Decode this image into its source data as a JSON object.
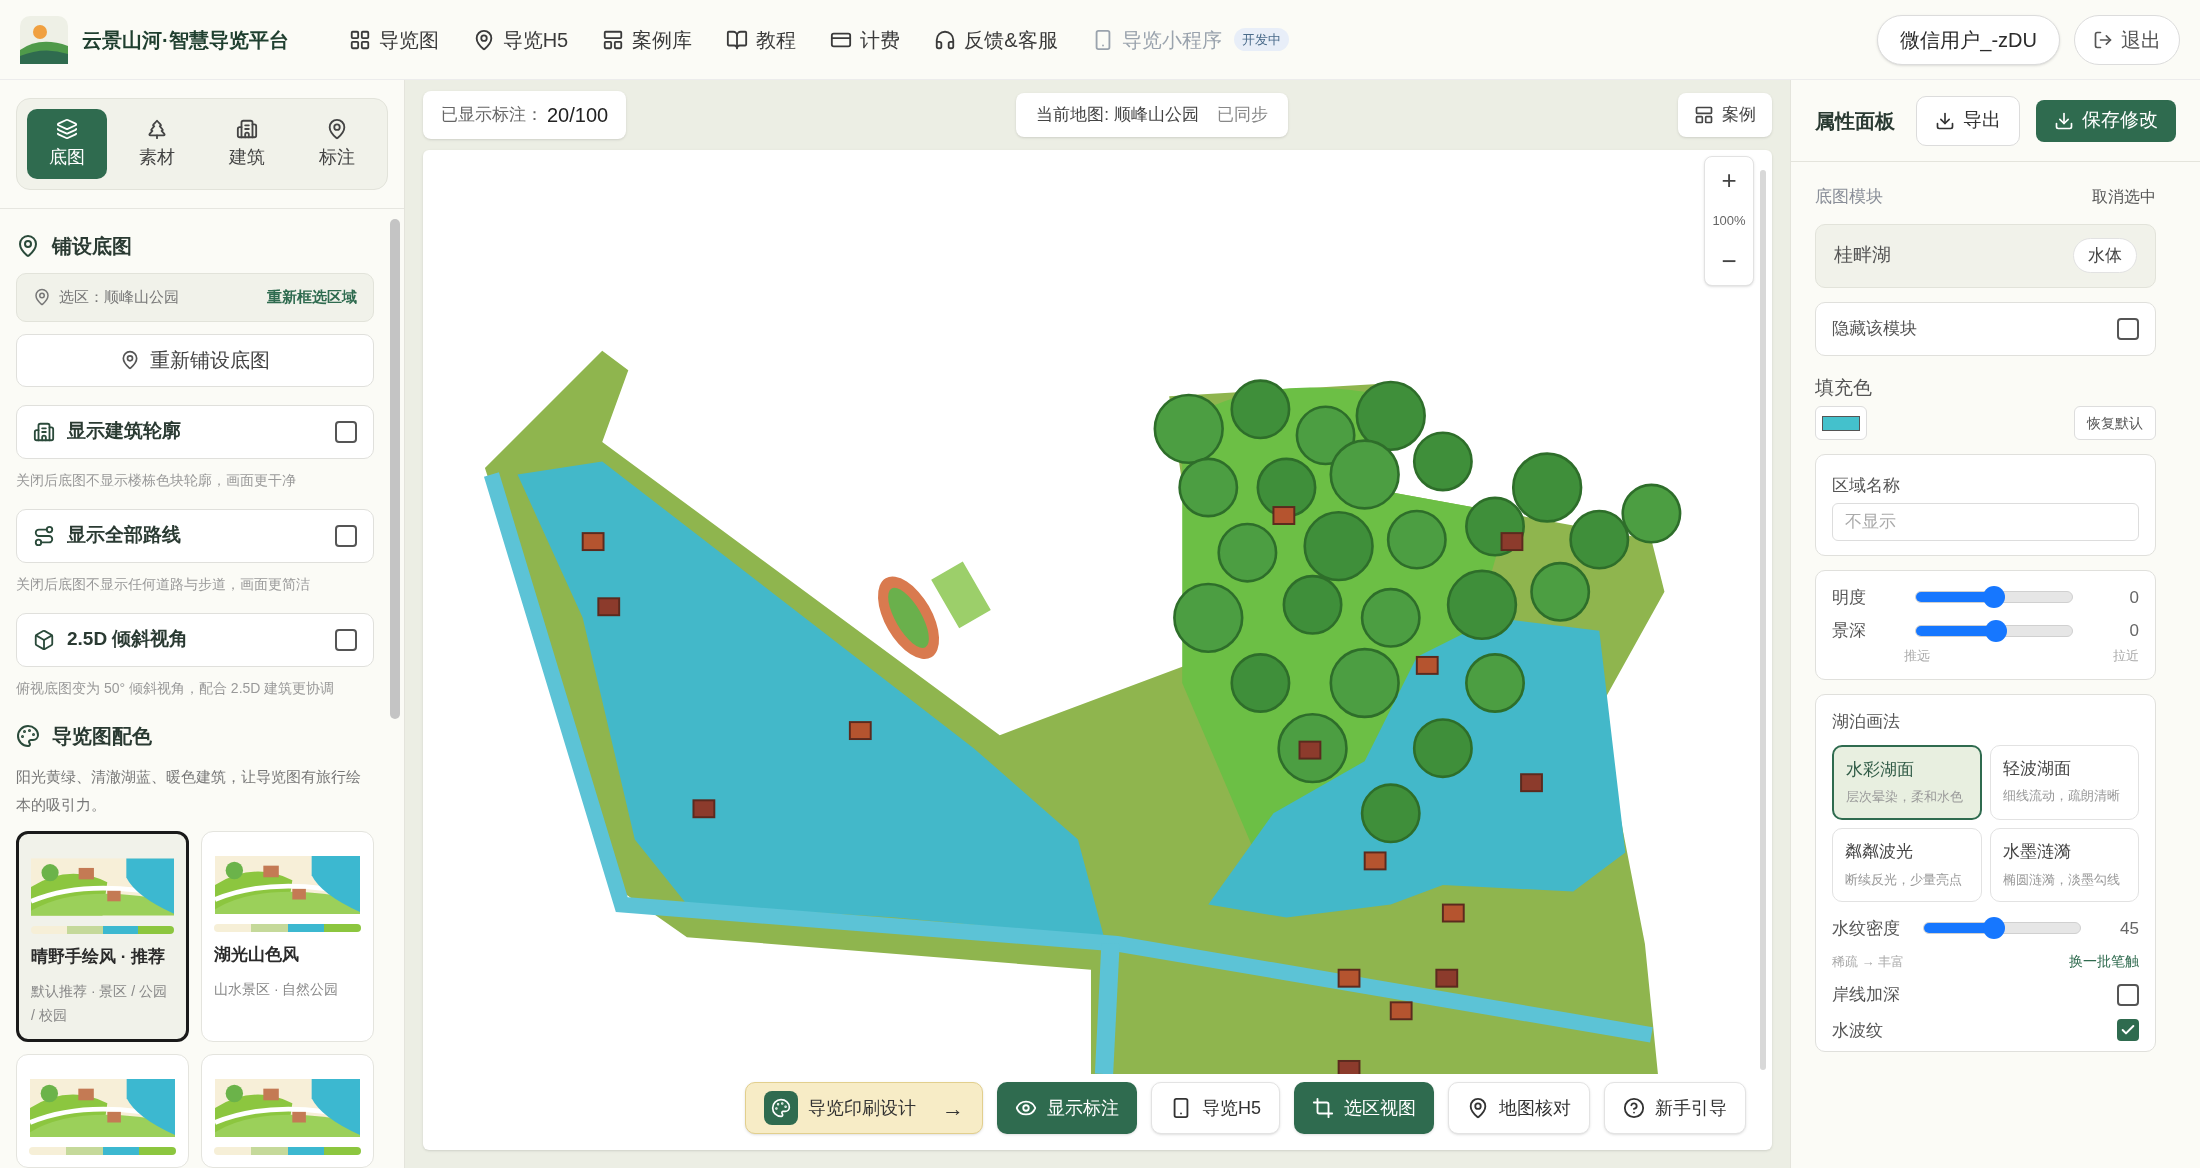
{
  "header": {
    "title": "云景山河·智慧导览平台",
    "nav": [
      {
        "label": "导览图",
        "disabled": false
      },
      {
        "label": "导览H5",
        "disabled": false
      },
      {
        "label": "案例库",
        "disabled": false
      },
      {
        "label": "教程",
        "disabled": false
      },
      {
        "label": "计费",
        "disabled": false
      },
      {
        "label": "反馈&客服",
        "disabled": false
      },
      {
        "label": "导览小程序",
        "disabled": true,
        "badge": "开发中"
      }
    ],
    "user": "微信用户_-zDU",
    "logout": "退出"
  },
  "sidebar": {
    "tabs": [
      {
        "label": "底图",
        "selected": true
      },
      {
        "label": "素材",
        "selected": false
      },
      {
        "label": "建筑",
        "selected": false
      },
      {
        "label": "标注",
        "selected": false
      }
    ],
    "section_title": "铺设底图",
    "selection": {
      "label": "选区：顺峰山公园",
      "action": "重新框选区域"
    },
    "relayout_button": "重新铺设底图",
    "toggles": [
      {
        "label": "显示建筑轮廓",
        "checked": false,
        "hint": "关闭后底图不显示楼栋色块轮廓，画面更干净"
      },
      {
        "label": "显示全部路线",
        "checked": false,
        "hint": "关闭后底图不显示任何道路与步道，画面更简洁"
      },
      {
        "label": "2.5D 倾斜视角",
        "checked": false,
        "hint": "俯视底图变为 50° 倾斜视角，配合 2.5D 建筑更协调"
      }
    ],
    "palette": {
      "title": "导览图配色",
      "description": "阳光黄绿、清澈湖蓝、暖色建筑，让导览图有旅行绘本的吸引力。",
      "themes": [
        {
          "name": "晴野手绘风 · 推荐",
          "description": "默认推荐 · 景区 / 公园 / 校园",
          "selected": true
        },
        {
          "name": "湖光山色风",
          "description": "山水景区 · 自然公园",
          "selected": false
        },
        {
          "selected": false
        },
        {
          "selected": false
        }
      ]
    }
  },
  "canvas": {
    "marker_count_label": "已显示标注：",
    "marker_count": "20/100",
    "current_map": "当前地图: 顺峰山公园",
    "sync_status": "已同步",
    "cases_button": "案例",
    "zoom": "100%",
    "zoom_in": "+",
    "zoom_out": "−",
    "toolbar": [
      {
        "label": "导览印刷设计",
        "kind": "featured",
        "arrow": "→"
      },
      {
        "label": "显示标注",
        "kind": "primary"
      },
      {
        "label": "导览H5",
        "kind": "secondary"
      },
      {
        "label": "选区视图",
        "kind": "primary"
      },
      {
        "label": "地图核对",
        "kind": "secondary"
      },
      {
        "label": "新手引导",
        "kind": "secondary"
      }
    ]
  },
  "properties": {
    "title": "属性面板",
    "export": "导出",
    "save": "保存修改",
    "module_label": "底图模块",
    "deselect": "取消选中",
    "module_name": "桂畔湖",
    "module_type": "水体",
    "hide_module": {
      "label": "隐藏该模块",
      "checked": false
    },
    "fill": {
      "label": "填充色",
      "color": "#44c1cc",
      "reset": "恢复默认"
    },
    "region_name": {
      "label": "区域名称",
      "placeholder": "不显示"
    },
    "sliders": [
      {
        "label": "明度",
        "level": 0.5,
        "reading": "0"
      },
      {
        "label": "景深",
        "level": 0.51,
        "reading": "0",
        "min": "推远",
        "max": "拉近"
      }
    ],
    "lake": {
      "title": "湖泊画法",
      "styles": [
        {
          "name": "水彩湖面",
          "description": "层次晕染，柔和水色",
          "selected": true
        },
        {
          "name": "轻波湖面",
          "description": "细线流动，疏朗清晰",
          "selected": false
        },
        {
          "name": "粼粼波光",
          "description": "断续反光，少量亮点",
          "selected": false
        },
        {
          "name": "水墨涟漪",
          "description": "椭圆涟漪，淡墨勾线",
          "selected": false
        }
      ],
      "density": {
        "label": "水纹密度",
        "level": 0.45,
        "reading": "45"
      },
      "density_hint": "稀疏 → 丰富",
      "reshuffle": "换一批笔触",
      "checks": [
        {
          "label": "岸线加深",
          "checked": false
        },
        {
          "label": "水波纹",
          "checked": true
        }
      ]
    }
  }
}
